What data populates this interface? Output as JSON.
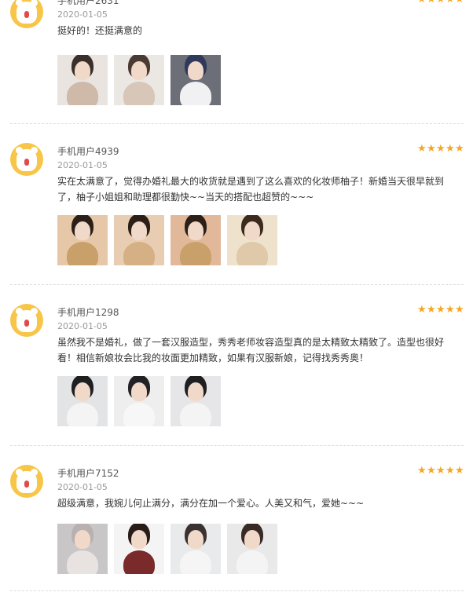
{
  "reviews": [
    {
      "user": "手机用户2631",
      "date": "2020-01-05",
      "text": "挺好的！还挺满意的",
      "rating": 5,
      "photos": [
        {
          "bg": "#e9e4e0",
          "fig": "#cfb9a8",
          "hair": "#3a2f2a"
        },
        {
          "bg": "#ebe7e3",
          "fig": "#d8c6b8",
          "hair": "#4a3a32"
        },
        {
          "bg": "#6d6f78",
          "fig": "#f1f1f3",
          "hair": "#2f3a5a"
        }
      ]
    },
    {
      "user": "手机用户4939",
      "date": "2020-01-05",
      "text": "实在太满意了，觉得办婚礼最大的收货就是遇到了这么喜欢的化妆师柚子！新婚当天很早就到了，柚子小姐姐和助理都很勤快~~当天的搭配也超赞的~~~",
      "rating": 5,
      "photos": [
        {
          "bg": "#e6c7a7",
          "fig": "#c9a06a",
          "hair": "#2c1f18"
        },
        {
          "bg": "#e8cdb2",
          "fig": "#d4b084",
          "hair": "#2c1f18"
        },
        {
          "bg": "#e2b89b",
          "fig": "#c9a06a",
          "hair": "#2c1f18"
        },
        {
          "bg": "#efe2cc",
          "fig": "#dfc9a8",
          "hair": "#3b2a1d"
        }
      ]
    },
    {
      "user": "手机用户1298",
      "date": "2020-01-05",
      "text": "虽然我不是婚礼，做了一套汉服造型，秀秀老师妆容造型真的是太精致太精致了。造型也很好看！相信新娘妆会比我的妆面更加精致，如果有汉服新娘，记得找秀秀奥！",
      "rating": 5,
      "photos": [
        {
          "bg": "#e3e4e6",
          "fig": "#f4f4f4",
          "hair": "#1f1f22"
        },
        {
          "bg": "#eeeeee",
          "fig": "#f7f7f7",
          "hair": "#222226"
        },
        {
          "bg": "#e6e6e8",
          "fig": "#f4f4f4",
          "hair": "#1f1f22"
        }
      ]
    },
    {
      "user": "手机用户7152",
      "date": "2020-01-05",
      "text": "超级满意，我婉儿何止满分，满分在加一个爱心。人美又和气，爱她~~~",
      "rating": 5,
      "photos": [
        {
          "bg": "#c9c6c8",
          "fig": "#e8e2e0",
          "hair": "#b9b1b0"
        },
        {
          "bg": "#f4f4f4",
          "fig": "#7a2a2a",
          "hair": "#2a1c18"
        },
        {
          "bg": "#e9eaec",
          "fig": "#f5f5f5",
          "hair": "#3a3230"
        },
        {
          "bg": "#e9e9ea",
          "fig": "#f4f4f4",
          "hair": "#3a2a26"
        }
      ]
    }
  ]
}
